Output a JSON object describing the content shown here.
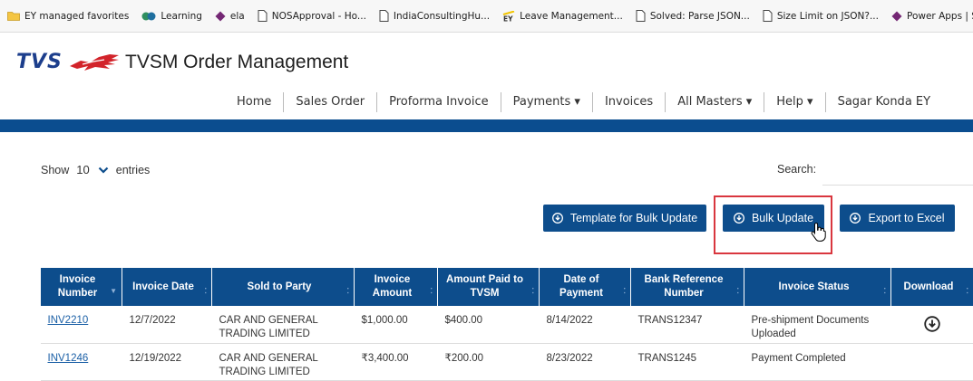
{
  "bookmarks": [
    {
      "label": "EY managed favorites",
      "icon": "folder-icon"
    },
    {
      "label": "Learning",
      "icon": "learning-icon"
    },
    {
      "label": "ela",
      "icon": "power-apps-icon"
    },
    {
      "label": "NOSApproval - Ho...",
      "icon": "page-icon"
    },
    {
      "label": "IndiaConsultingHu...",
      "icon": "page-icon"
    },
    {
      "label": "Leave Management...",
      "icon": "ey-icon"
    },
    {
      "label": "Solved: Parse JSON...",
      "icon": "page-icon"
    },
    {
      "label": "Size Limit on JSON?...",
      "icon": "page-icon"
    },
    {
      "label": "Power Apps | Soluti...",
      "icon": "power-apps-icon"
    }
  ],
  "header": {
    "logo_text": "TVS",
    "app_title": "TVSM Order Management",
    "brand_color": "#0d4d8c"
  },
  "nav": {
    "items": [
      "Home",
      "Sales Order",
      "Proforma Invoice",
      "Payments ▾",
      "Invoices",
      "All Masters ▾",
      "Help ▾",
      "Sagar Konda EY"
    ]
  },
  "controls": {
    "show_label": "Show",
    "page_length": "10",
    "entries_label": "entries",
    "search_label": "Search:",
    "search_value": ""
  },
  "buttons": {
    "template": "Template for Bulk Update",
    "bulk_update": "Bulk Update",
    "export": "Export to Excel"
  },
  "table": {
    "columns": [
      "Invoice Number",
      "Invoice Date",
      "Sold to Party",
      "Invoice Amount",
      "Amount Paid to TVSM",
      "Date of Payment",
      "Bank Reference Number",
      "Invoice Status",
      "Download"
    ],
    "rows": [
      {
        "invoice_number": "INV2210",
        "invoice_date": "12/7/2022",
        "sold_to_party": "CAR AND GENERAL TRADING LIMITED",
        "invoice_amount": "$1,000.00",
        "amount_paid": "$400.00",
        "date_of_payment": "8/14/2022",
        "bank_reference": "TRANS12347",
        "status": "Pre-shipment Documents Uploaded",
        "download_icon": "download-icon"
      },
      {
        "invoice_number": "INV1246",
        "invoice_date": "12/19/2022",
        "sold_to_party": "CAR AND GENERAL TRADING LIMITED",
        "invoice_amount": "₹3,400.00",
        "amount_paid": "₹200.00",
        "date_of_payment": "8/23/2022",
        "bank_reference": "TRANS1245",
        "status": "Payment Completed",
        "download_icon": ""
      }
    ]
  }
}
